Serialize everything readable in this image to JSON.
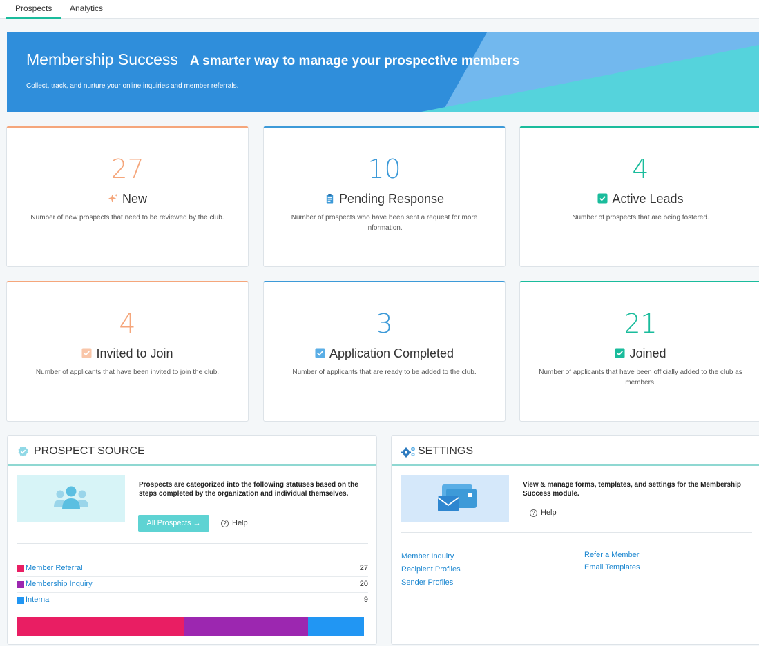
{
  "tabs": [
    {
      "label": "Prospects",
      "active": true
    },
    {
      "label": "Analytics",
      "active": false
    }
  ],
  "banner": {
    "title": "Membership Success",
    "tagline": "A smarter way to manage your prospective members",
    "subtitle": "Collect, track, and nurture your online inquiries and member referrals."
  },
  "colors": {
    "orange": "#f5a67b",
    "blue": "#3d9ad8",
    "green": "#1abc9c",
    "link": "#1a86d0",
    "referral": "#e91e63",
    "inquiry": "#9c27b0",
    "internal": "#2196f3"
  },
  "stats": [
    {
      "value": "27",
      "label": "New",
      "description": "Number of new prospects that need to be reviewed by the club.",
      "icon": "sparkle-icon"
    },
    {
      "value": "10",
      "label": "Pending Response",
      "description": "Number of prospects who have been sent a request for more information.",
      "icon": "clipboard-icon"
    },
    {
      "value": "4",
      "label": "Active Leads",
      "description": "Number of prospects that are being fostered.",
      "icon": "checkbox-icon"
    },
    {
      "value": "4",
      "label": "Invited to Join",
      "description": "Number of applicants that have been invited to join the club.",
      "icon": "checkbox-icon"
    },
    {
      "value": "3",
      "label": "Application Completed",
      "description": "Number of applicants that are ready to be added to the club.",
      "icon": "checkbox-icon"
    },
    {
      "value": "21",
      "label": "Joined",
      "description": "Number of applicants that have been officially added to the club as members.",
      "icon": "checkbox-icon"
    }
  ],
  "prospect_source": {
    "title": "PROSPECT SOURCE",
    "description": "Prospects are categorized into the following statuses based on the steps completed by the organization and individual themselves.",
    "button_label": "All Prospects →",
    "help_label": "Help",
    "sources": [
      {
        "name": "Member Referral",
        "count": "27",
        "value": 27,
        "color": "#e91e63"
      },
      {
        "name": "Membership Inquiry",
        "count": "20",
        "value": 20,
        "color": "#9c27b0"
      },
      {
        "name": "Internal",
        "count": "9",
        "value": 9,
        "color": "#2196f3"
      }
    ]
  },
  "settings": {
    "title": "SETTINGS",
    "description": "View & manage forms, templates, and settings for  the Membership Success module.",
    "help_label": "Help",
    "links_col1": [
      "Member Inquiry",
      "Recipient Profiles",
      "Sender Profiles"
    ],
    "links_col2": [
      "Refer a Member",
      "Email Templates"
    ]
  }
}
